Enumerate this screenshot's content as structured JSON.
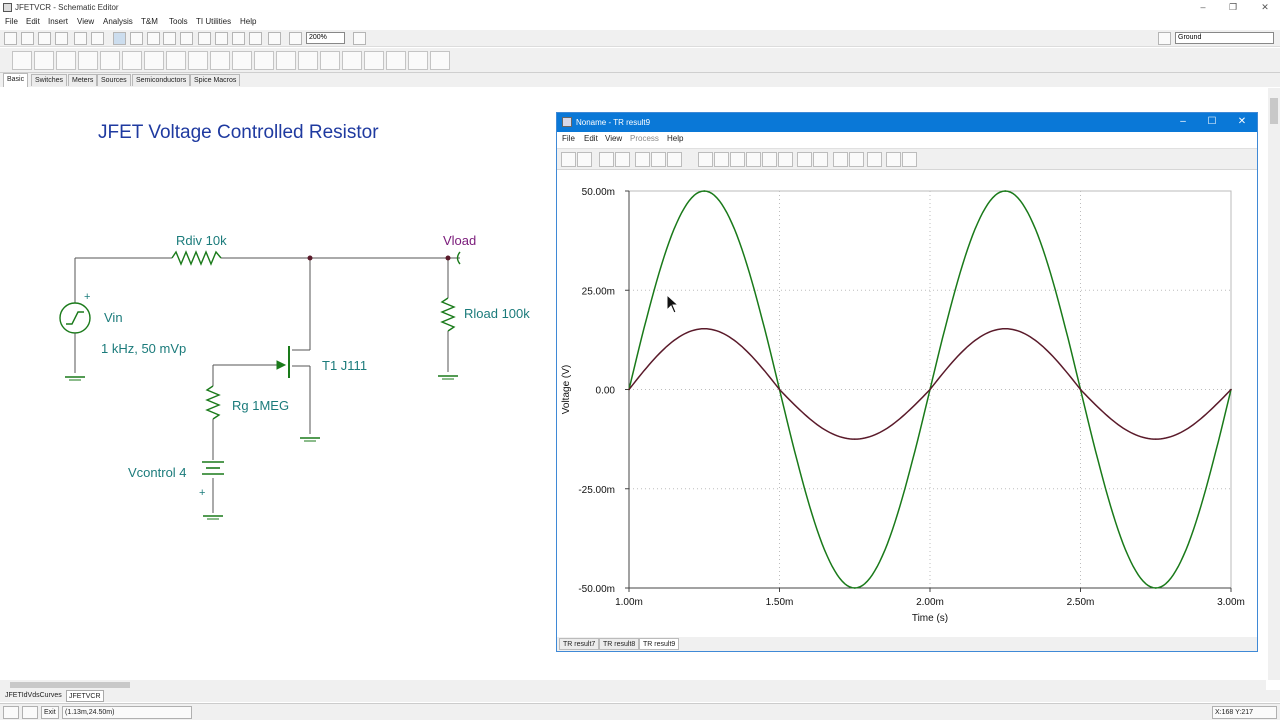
{
  "window": {
    "title": "JFETVCR - Schematic Editor"
  },
  "menu": [
    "File",
    "Edit",
    "Insert",
    "View",
    "Analysis",
    "T&M",
    "Tools",
    "TI Utilities",
    "Help"
  ],
  "toolbar": {
    "zoom": "200%",
    "ground_select": "Ground"
  },
  "component_tabs": [
    "Basic",
    "Switches",
    "Meters",
    "Sources",
    "Semiconductors",
    "Spice Macros"
  ],
  "schematic": {
    "title": "JFET Voltage Controlled Resistor",
    "rdiv": "Rdiv 10k",
    "vload": "Vload",
    "vin": "Vin",
    "vin_spec": "1 kHz, 50 mVp",
    "rload": "Rload 100k",
    "t1": "T1 J111",
    "rg": "Rg 1MEG",
    "vcontrol": "Vcontrol 4",
    "plus": "+"
  },
  "result_window": {
    "title": "Noname - TR result9",
    "menu": [
      "File",
      "Edit",
      "View",
      "Process",
      "Help"
    ],
    "tabs": [
      "TR result7",
      "TR result8",
      "TR result9"
    ]
  },
  "chart_data": {
    "type": "line",
    "xlabel": "Time (s)",
    "ylabel": "Voltage (V)",
    "xlim": [
      0.001,
      0.003
    ],
    "ylim": [
      -0.05,
      0.05
    ],
    "x_ticks": [
      "1.00m",
      "1.50m",
      "2.00m",
      "2.50m",
      "3.00m"
    ],
    "y_ticks": [
      "50.00m",
      "25.00m",
      "0.00",
      "-25.00m",
      "-50.00m"
    ],
    "grid": true,
    "series": [
      {
        "color": "#1a7a1a",
        "x": [
          0.001,
          0.00125,
          0.0015,
          0.00175,
          0.002,
          0.00225,
          0.0025,
          0.00275,
          0.003
        ],
        "y": [
          0,
          0.05,
          0,
          -0.05,
          0,
          0.05,
          0,
          -0.05,
          0
        ]
      },
      {
        "color": "#5a1a2a",
        "x": [
          0.001,
          0.00125,
          0.0015,
          0.00175,
          0.002,
          0.00225,
          0.0025,
          0.00275,
          0.003
        ],
        "y": [
          0,
          0.0153,
          0,
          -0.0125,
          0,
          0.0153,
          0,
          -0.0125,
          0
        ]
      }
    ]
  },
  "doc_tabs": [
    "JFETIdVdsCurves",
    "JFETVCR"
  ],
  "status": {
    "exit": "Exit",
    "coords": "(1.13m,24.50m)",
    "xy": "X:168  Y:217"
  }
}
